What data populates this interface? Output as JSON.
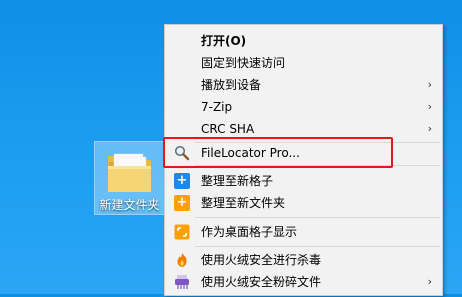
{
  "desktop": {
    "folder_label": "新建文件夹"
  },
  "menu": {
    "items": [
      {
        "label": "打开(O)",
        "bold": true
      },
      {
        "label": "固定到快速访问"
      },
      {
        "label": "播放到设备",
        "submenu": true
      },
      {
        "label": "7-Zip",
        "submenu": true
      },
      {
        "label": "CRC SHA",
        "submenu": true
      },
      {
        "label": "FileLocator Pro...",
        "icon": "magnifier-icon"
      },
      {
        "label": "整理至新格子",
        "icon": "add-grid-icon"
      },
      {
        "label": "整理至新文件夹",
        "icon": "add-folder-icon"
      },
      {
        "label": "作为桌面格子显示",
        "icon": "grid-display-icon"
      },
      {
        "label": "使用火绒安全进行杀毒",
        "icon": "huorong-shield-icon"
      },
      {
        "label": "使用火绒安全粉碎文件",
        "icon": "shredder-icon",
        "submenu": true
      }
    ],
    "submenu_arrow": "›"
  },
  "colors": {
    "desktop_bg": "#1a9cf0",
    "menu_bg": "#f2f2f2",
    "highlight_border": "#e0191b",
    "grid_icon_blue": "#1e88e5",
    "folder_icon_orange": "#ffa000",
    "huorong_orange": "#f57c00",
    "shredder_purple": "#7e57c2"
  }
}
